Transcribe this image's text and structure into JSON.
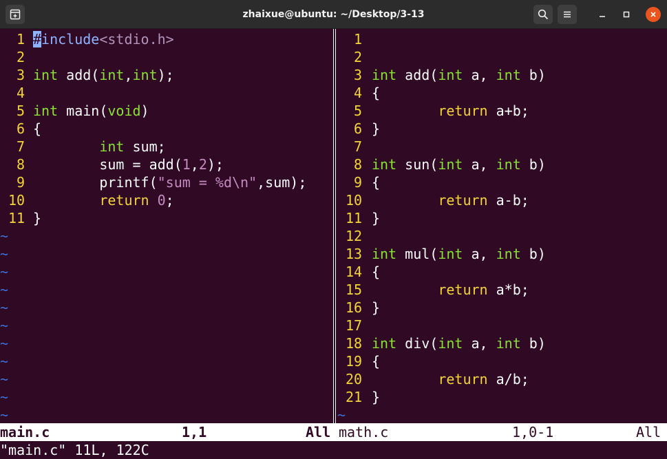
{
  "window": {
    "title": "zhaixue@ubuntu: ~/Desktop/3-13"
  },
  "colors": {
    "background": "#300a24",
    "line_number": "#f2d43a",
    "type_keyword": "#8ae234",
    "preproc": "#8fb3ff",
    "constant": "#c58ac0",
    "statement": "#f2d43a",
    "tilde": "#3d6fd9",
    "close_button": "#e9541f"
  },
  "icons": {
    "new_tab": "new-tab-icon",
    "search": "search-icon",
    "menu": "hamburger-menu-icon",
    "minimize": "minimize-icon",
    "maximize": "maximize-icon",
    "close": "close-icon"
  },
  "left_pane": {
    "file": "main.c",
    "lines": [
      {
        "no": " 1",
        "tokens": [
          [
            "cursor",
            "#"
          ],
          [
            "inc",
            "include"
          ],
          [
            "hdr",
            "<stdio.h>"
          ]
        ]
      },
      {
        "no": " 2",
        "tokens": []
      },
      {
        "no": " 3",
        "tokens": [
          [
            "ty",
            "int"
          ],
          [
            "pl",
            " add("
          ],
          [
            "ty",
            "int"
          ],
          [
            "pl",
            ","
          ],
          [
            "ty",
            "int"
          ],
          [
            "pl",
            ");"
          ]
        ]
      },
      {
        "no": " 4",
        "tokens": []
      },
      {
        "no": " 5",
        "tokens": [
          [
            "ty",
            "int"
          ],
          [
            "pl",
            " main("
          ],
          [
            "ty",
            "void"
          ],
          [
            "pl",
            ")"
          ]
        ]
      },
      {
        "no": " 6",
        "tokens": [
          [
            "pl",
            "{"
          ]
        ]
      },
      {
        "no": " 7",
        "tokens": [
          [
            "pl",
            "        "
          ],
          [
            "ty",
            "int"
          ],
          [
            "pl",
            " sum;"
          ]
        ]
      },
      {
        "no": " 8",
        "tokens": [
          [
            "pl",
            "        sum = add("
          ],
          [
            "num",
            "1"
          ],
          [
            "pl",
            ","
          ],
          [
            "num",
            "2"
          ],
          [
            "pl",
            ");"
          ]
        ]
      },
      {
        "no": " 9",
        "tokens": [
          [
            "pl",
            "        printf("
          ],
          [
            "str",
            "\"sum = %d\\n\""
          ],
          [
            "pl",
            ",sum);"
          ]
        ]
      },
      {
        "no": "10",
        "tokens": [
          [
            "pl",
            "        "
          ],
          [
            "kw",
            "return"
          ],
          [
            "pl",
            " "
          ],
          [
            "num",
            "0"
          ],
          [
            "pl",
            ";"
          ]
        ]
      },
      {
        "no": "11",
        "tokens": [
          [
            "pl",
            "}"
          ]
        ]
      }
    ],
    "tilde_count": 11,
    "status": {
      "name": "main.c",
      "position": "1,1",
      "scroll": "All"
    }
  },
  "right_pane": {
    "file": "math.c",
    "lines": [
      {
        "no": " 1",
        "tokens": []
      },
      {
        "no": " 2",
        "tokens": []
      },
      {
        "no": " 3",
        "tokens": [
          [
            "ty",
            "int"
          ],
          [
            "pl",
            " add("
          ],
          [
            "ty",
            "int"
          ],
          [
            "pl",
            " a, "
          ],
          [
            "ty",
            "int"
          ],
          [
            "pl",
            " b)"
          ]
        ]
      },
      {
        "no": " 4",
        "tokens": [
          [
            "pl",
            "{"
          ]
        ]
      },
      {
        "no": " 5",
        "tokens": [
          [
            "pl",
            "        "
          ],
          [
            "kw",
            "return"
          ],
          [
            "pl",
            " a+b;"
          ]
        ]
      },
      {
        "no": " 6",
        "tokens": [
          [
            "pl",
            "}"
          ]
        ]
      },
      {
        "no": " 7",
        "tokens": []
      },
      {
        "no": " 8",
        "tokens": [
          [
            "ty",
            "int"
          ],
          [
            "pl",
            " sun("
          ],
          [
            "ty",
            "int"
          ],
          [
            "pl",
            " a, "
          ],
          [
            "ty",
            "int"
          ],
          [
            "pl",
            " b)"
          ]
        ]
      },
      {
        "no": " 9",
        "tokens": [
          [
            "pl",
            "{"
          ]
        ]
      },
      {
        "no": "10",
        "tokens": [
          [
            "pl",
            "        "
          ],
          [
            "kw",
            "return"
          ],
          [
            "pl",
            " a-b;"
          ]
        ]
      },
      {
        "no": "11",
        "tokens": [
          [
            "pl",
            "}"
          ]
        ]
      },
      {
        "no": "12",
        "tokens": []
      },
      {
        "no": "13",
        "tokens": [
          [
            "ty",
            "int"
          ],
          [
            "pl",
            " mul("
          ],
          [
            "ty",
            "int"
          ],
          [
            "pl",
            " a, "
          ],
          [
            "ty",
            "int"
          ],
          [
            "pl",
            " b)"
          ]
        ]
      },
      {
        "no": "14",
        "tokens": [
          [
            "pl",
            "{"
          ]
        ]
      },
      {
        "no": "15",
        "tokens": [
          [
            "pl",
            "        "
          ],
          [
            "kw",
            "return"
          ],
          [
            "pl",
            " a*b;"
          ]
        ]
      },
      {
        "no": "16",
        "tokens": [
          [
            "pl",
            "}"
          ]
        ]
      },
      {
        "no": "17",
        "tokens": []
      },
      {
        "no": "18",
        "tokens": [
          [
            "ty",
            "int"
          ],
          [
            "pl",
            " div("
          ],
          [
            "ty",
            "int"
          ],
          [
            "pl",
            " a, "
          ],
          [
            "ty",
            "int"
          ],
          [
            "pl",
            " b)"
          ]
        ]
      },
      {
        "no": "19",
        "tokens": [
          [
            "pl",
            "{"
          ]
        ]
      },
      {
        "no": "20",
        "tokens": [
          [
            "pl",
            "        "
          ],
          [
            "kw",
            "return"
          ],
          [
            "pl",
            " a/b;"
          ]
        ]
      },
      {
        "no": "21",
        "tokens": [
          [
            "pl",
            "}"
          ]
        ]
      }
    ],
    "tilde_count": 1,
    "status": {
      "name": "math.c",
      "position": "1,0-1",
      "scroll": "All"
    }
  },
  "command_line": "\"main.c\" 11L, 122C"
}
